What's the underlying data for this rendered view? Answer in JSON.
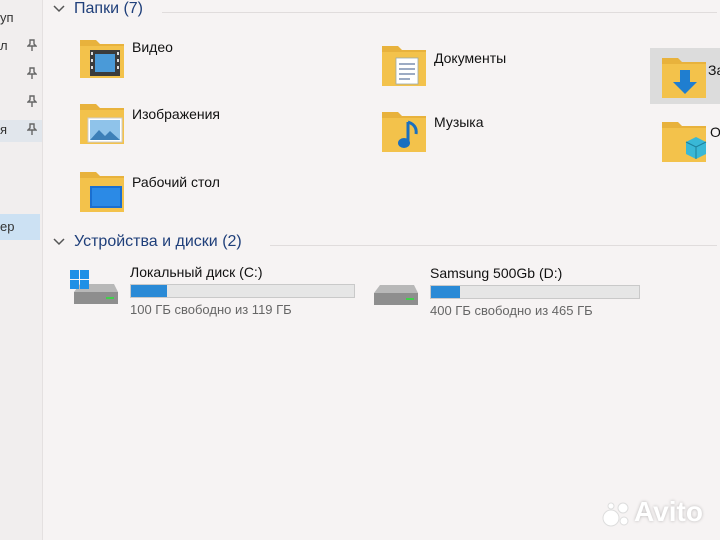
{
  "nav": {
    "items": [
      {
        "label": "уп"
      },
      {
        "label": "л"
      },
      {
        "label": ""
      },
      {
        "label": ""
      },
      {
        "label": "я"
      }
    ],
    "selected_label": "ер"
  },
  "folders_section": {
    "title": "Папки (7)",
    "items": [
      {
        "label": "Видео",
        "icon": "video-folder-icon"
      },
      {
        "label": "Документы",
        "icon": "documents-folder-icon"
      },
      {
        "label": "За",
        "icon": "downloads-folder-icon"
      },
      {
        "label": "Изображения",
        "icon": "pictures-folder-icon"
      },
      {
        "label": "Музыка",
        "icon": "music-folder-icon"
      },
      {
        "label": "Об",
        "icon": "3d-objects-folder-icon"
      },
      {
        "label": "Рабочий стол",
        "icon": "desktop-folder-icon"
      }
    ]
  },
  "drives_section": {
    "title": "Устройства и диски (2)",
    "drives": [
      {
        "name": "Локальный диск (C:)",
        "free_text": "100 ГБ свободно из 119 ГБ",
        "used_fraction": 0.16,
        "icon": "windows-drive-icon"
      },
      {
        "name": "Samsung 500Gb (D:)",
        "free_text": "400 ГБ свободно из 465 ГБ",
        "used_fraction": 0.14,
        "icon": "hard-drive-icon"
      }
    ]
  },
  "colors": {
    "accent": "#2a8ad6",
    "header": "#1f3f7a",
    "folder": "#f3c24b"
  },
  "watermark": {
    "text": "Avito"
  }
}
